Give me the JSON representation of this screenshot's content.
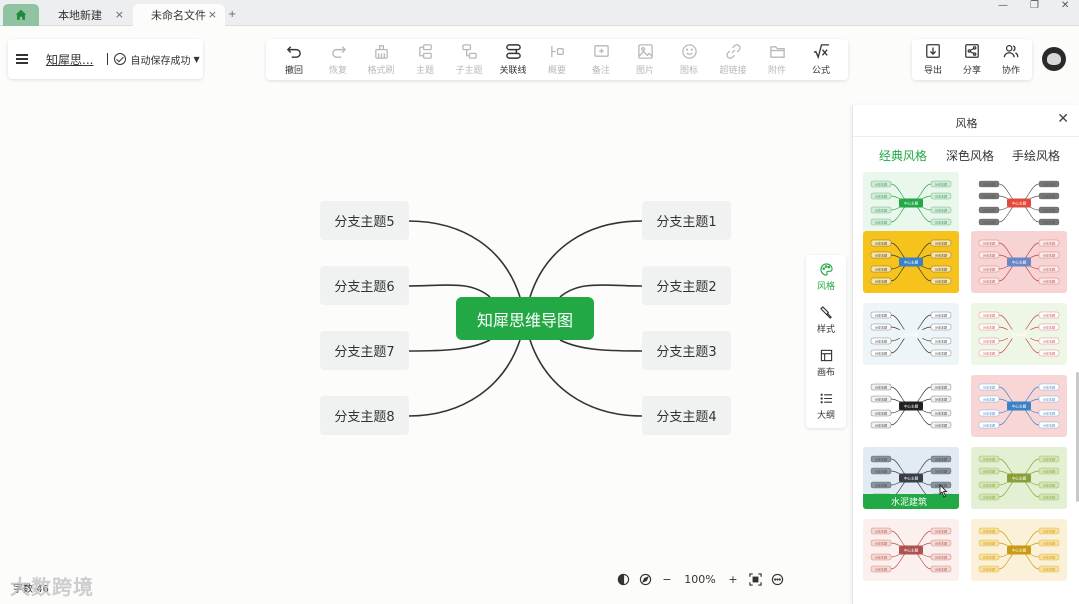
{
  "tabs": [
    {
      "label": "本地新建"
    },
    {
      "label": "未命名文件"
    }
  ],
  "new_tab": "+",
  "doc": {
    "title": "知犀思...",
    "save_state": "自动保存成功"
  },
  "toolbar": {
    "undo": "撤回",
    "redo": "恢复",
    "format_brush": "格式刷",
    "topic": "主题",
    "subtopic": "子主题",
    "relation": "关联线",
    "summary": "概要",
    "note": "备注",
    "image": "图片",
    "icon": "图标",
    "hyperlink": "超链接",
    "attachment": "附件",
    "formula": "公式"
  },
  "right_toolbar": {
    "export": "导出",
    "share": "分享",
    "collaborate": "协作"
  },
  "mindmap": {
    "central": "知犀思维导图",
    "branches_left": [
      "分支主题5",
      "分支主题6",
      "分支主题7",
      "分支主题8"
    ],
    "branches_right": [
      "分支主题1",
      "分支主题2",
      "分支主题3",
      "分支主题4"
    ],
    "colors": {
      "central": "#22a845",
      "branch_bg": "#f0f1f1",
      "line": "#333333"
    }
  },
  "side_tabs": [
    "风格",
    "样式",
    "画布",
    "大纲"
  ],
  "style_panel": {
    "title": "风格",
    "tabs": [
      "经典风格",
      "深色风格",
      "手绘风格"
    ],
    "hover_label": "水泥建筑",
    "thumb_center": "中心主题",
    "thumb_branch": "分支主题"
  },
  "status": {
    "word_count": "字数 46",
    "watermark": "大数跨境"
  },
  "zoom": {
    "minus": "−",
    "value": "100%",
    "plus": "+"
  }
}
